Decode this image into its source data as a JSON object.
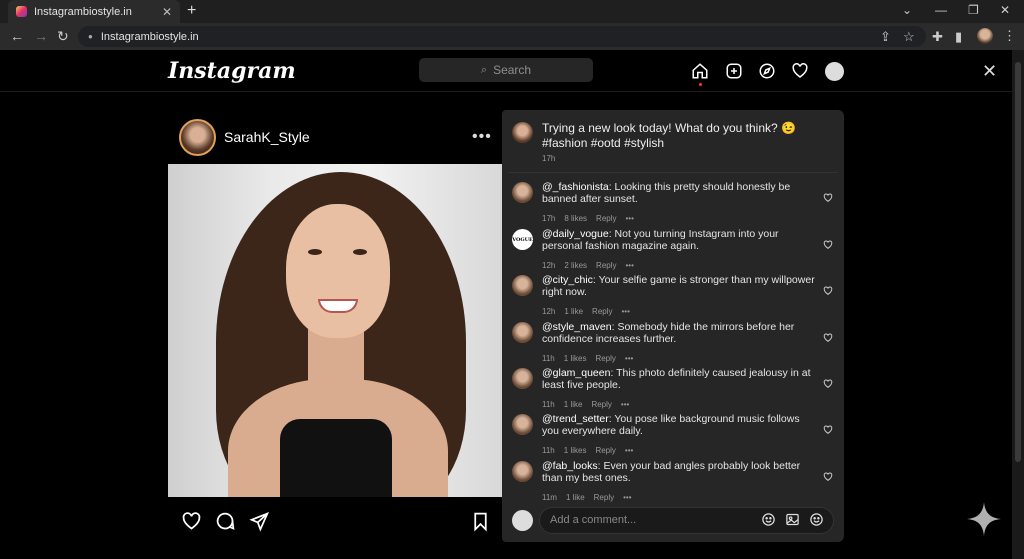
{
  "browser": {
    "tab_title": "Instagrambiostyle.in",
    "tab_close": "✕",
    "new_tab": "+",
    "url": "Instagrambiostyle.in"
  },
  "ig": {
    "logo": "Instagram",
    "search_placeholder": "Search",
    "close": "✕"
  },
  "post": {
    "username": "SarahK_Style",
    "more": "•••"
  },
  "caption": {
    "text": "Trying a new look today! What do you think? 😉 #fashion #ootd #stylish",
    "time": "17h"
  },
  "comments": [
    {
      "user": "@_fashionista",
      "text": ": Looking this pretty should honestly be banned after sunset.",
      "time": "17h",
      "likes": "8 likes",
      "reply": "Reply",
      "more": "•••",
      "avatar": "photo"
    },
    {
      "user": "@daily_vogue",
      "text": ": Not you turning Instagram into your personal fashion magazine again.",
      "time": "12h",
      "likes": "2 likes",
      "reply": "Reply",
      "more": "•••",
      "avatar": "vogue",
      "avatar_text": "VOGUE"
    },
    {
      "user": "@city_chic",
      "text": ": Your selfie game is stronger than my willpower right now.",
      "time": "12h",
      "likes": "1 like",
      "reply": "Reply",
      "more": "•••",
      "avatar": "photo"
    },
    {
      "user": "@style_maven",
      "text": ": Somebody hide the mirrors before her confidence increases further.",
      "time": "11h",
      "likes": "1 likes",
      "reply": "Reply",
      "more": "•••",
      "avatar": "photo"
    },
    {
      "user": "@glam_queen",
      "text": ": This photo definitely caused jealousy in at least five people.",
      "time": "11h",
      "likes": "1 like",
      "reply": "Reply",
      "more": "•••",
      "avatar": "photo"
    },
    {
      "user": "@trend_setter",
      "text": ": You pose like background music follows you everywhere daily.",
      "time": "11h",
      "likes": "1 likes",
      "reply": "Reply",
      "more": "•••",
      "avatar": "photo"
    },
    {
      "user": "@fab_looks",
      "text": ": Even your bad angles probably look better than my best ones.",
      "time": "11m",
      "likes": "1 like",
      "reply": "Reply",
      "more": "•••",
      "avatar": "photo"
    }
  ],
  "comment_box": {
    "placeholder": "Add a comment..."
  },
  "colors": {
    "panel_bg": "#262626",
    "page_bg": "#000000",
    "story_ring": "#e1a15a",
    "notification_dot": "#ff3040"
  }
}
